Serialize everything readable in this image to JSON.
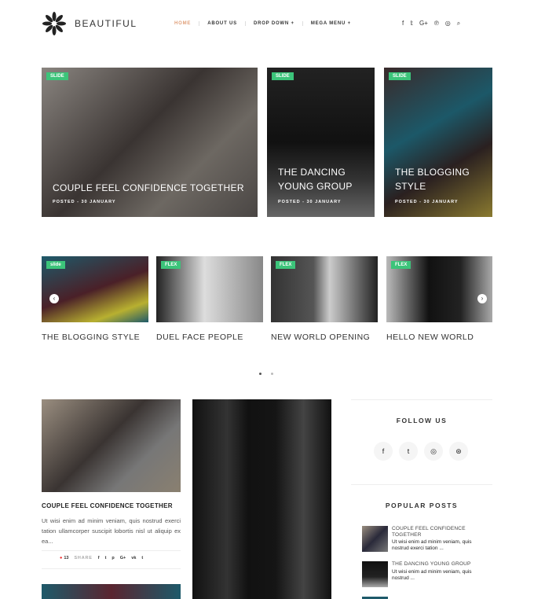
{
  "header": {
    "logo": "BEAUTIFUL",
    "nav": [
      "HOME",
      "ABOUT US",
      "DROP DOWN +",
      "MEGA MENU +"
    ],
    "social_icons": [
      "facebook-icon",
      "twitter-icon",
      "google-plus-icon",
      "pinterest-icon",
      "instagram-icon",
      "search-icon"
    ],
    "social_glyphs": [
      "f",
      "𝕥",
      "G+",
      "℗",
      "◎",
      "⌕"
    ]
  },
  "hero": [
    {
      "tag": "SLIDE",
      "title": "COUPLE FEEL CONFIDENCE TOGETHER",
      "meta": "POSTED - 30 JANUARY"
    },
    {
      "tag": "SLIDE",
      "title": "THE DANCING YOUNG GROUP",
      "meta": "POSTED - 30 JANUARY"
    },
    {
      "tag": "SLIDE",
      "title": "THE BLOGGING STYLE",
      "meta": "POSTED - 30 JANUARY"
    }
  ],
  "carousel": [
    {
      "tag": "slide",
      "title": "THE BLOGGING STYLE"
    },
    {
      "tag": "FLEX",
      "title": "DUEL FACE PEOPLE"
    },
    {
      "tag": "FLEX",
      "title": "NEW WORLD OPENING"
    },
    {
      "tag": "FLEX",
      "title": "HELLO NEW WORLD"
    }
  ],
  "post": {
    "title": "COUPLE FEEL CONFIDENCE TOGETHER",
    "excerpt": "Ut wisi enim ad minim veniam, quis nostrud exerci tation ullamcorper suscipit lobortis nisl ut aliquip ex ea...",
    "comments": "13",
    "share": "SHARE",
    "share_glyphs": [
      "f",
      "t",
      "p",
      "G+",
      "vk",
      "t"
    ]
  },
  "sidebar": {
    "follow_title": "FOLLOW US",
    "follow_glyphs": [
      "f",
      "t",
      "◎",
      "⊛"
    ],
    "popular_title": "POPULAR POSTS",
    "popular": [
      {
        "title": "COUPLE FEEL CONFIDENCE TOGETHER",
        "excerpt": "Ut wisi enim ad minim veniam, quis nostrud exerci tation ..."
      },
      {
        "title": "THE DANCING YOUNG GROUP",
        "excerpt": "Ut wisi enim ad minim veniam, quis nostrud ..."
      }
    ]
  },
  "colors": {
    "accent": "#e0a07a",
    "tag": "#3cc47a"
  }
}
